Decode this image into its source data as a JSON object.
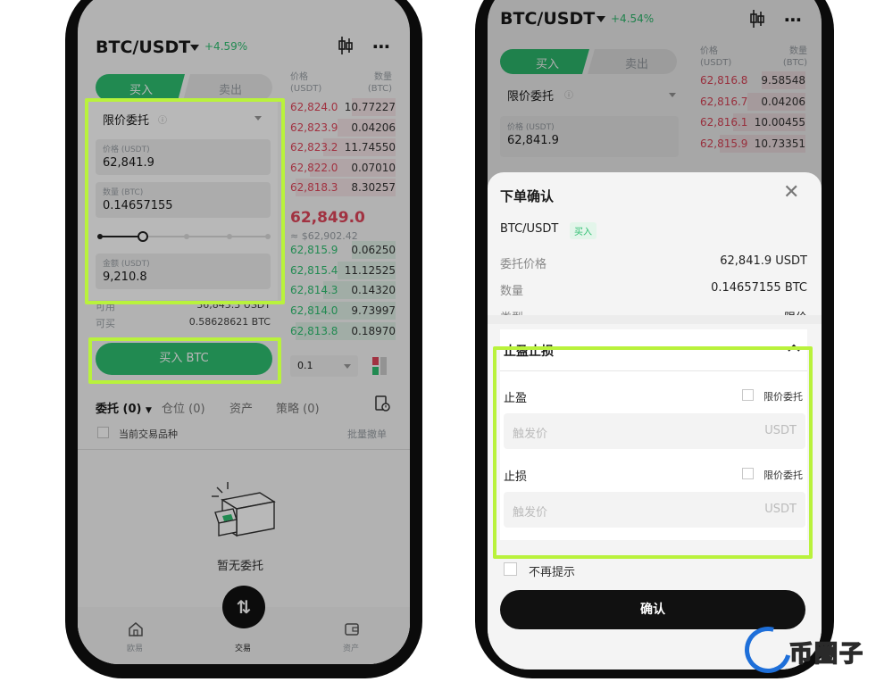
{
  "left": {
    "pair": "BTC/USDT",
    "change": "+4.59%",
    "tabs": {
      "buy": "买入",
      "sell": "卖出"
    },
    "book_headers": {
      "price": "价格",
      "price_unit": "(USDT)",
      "qty": "数量",
      "qty_unit": "(BTC)"
    },
    "order_type": "限价委托",
    "price_label": "价格 (USDT)",
    "price_value": "62,841.9",
    "qty_label": "数量 (BTC)",
    "qty_value": "0.14657155",
    "amount_label": "金额 (USDT)",
    "amount_value": "9,210.8",
    "slider_fraction": 0.25,
    "asks": [
      {
        "price": "62,824.0",
        "qty": "10.77227"
      },
      {
        "price": "62,823.9",
        "qty": "0.04206"
      },
      {
        "price": "62,823.2",
        "qty": "11.74550"
      },
      {
        "price": "62,822.0",
        "qty": "0.07010"
      },
      {
        "price": "62,818.3",
        "qty": "8.30257"
      }
    ],
    "last_price": "62,849.0",
    "last_price_usd": "≈ $62,902.42",
    "bids": [
      {
        "price": "62,815.9",
        "qty": "0.06250"
      },
      {
        "price": "62,815.4",
        "qty": "11.12525"
      },
      {
        "price": "62,814.3",
        "qty": "0.14320"
      },
      {
        "price": "62,814.0",
        "qty": "9.73997"
      },
      {
        "price": "62,813.8",
        "qty": "0.18970"
      }
    ],
    "available_label": "可用",
    "available_value": "36,843.3 USDT",
    "can_buy_label": "可买",
    "can_buy_value": "0.58628621 BTC",
    "buy_button": "买入 BTC",
    "depth_step": "0.1",
    "bottom_tabs": [
      "委托 (0)",
      "仓位 (0)",
      "资产",
      "策略 (0)"
    ],
    "current_pair_only": "当前交易品种",
    "batch_cancel": "批量撤单",
    "empty_text": "暂无委托",
    "nav": {
      "home": "欧易",
      "trade": "交易",
      "assets": "资产"
    }
  },
  "right": {
    "pair": "BTC/USDT",
    "change": "+4.54%",
    "tabs": {
      "buy": "买入",
      "sell": "卖出"
    },
    "book_headers": {
      "price": "价格",
      "price_unit": "(USDT)",
      "qty": "数量",
      "qty_unit": "(BTC)"
    },
    "order_type": "限价委托",
    "price_label": "价格 (USDT)",
    "price_value": "62,841.9",
    "asks": [
      {
        "price": "62,816.8",
        "qty": "9.58548"
      },
      {
        "price": "62,816.7",
        "qty": "0.04206"
      },
      {
        "price": "62,816.1",
        "qty": "10.00455"
      },
      {
        "price": "62,815.9",
        "qty": "10.73351"
      }
    ],
    "sheet": {
      "title": "下单确认",
      "pair": "BTC/USDT",
      "side_badge": "买入",
      "rows": [
        {
          "label": "委托价格",
          "value": "62,841.9 USDT"
        },
        {
          "label": "数量",
          "value": "0.14657155 BTC"
        },
        {
          "label": "类型",
          "value": "限价"
        }
      ],
      "tpsl_title": "止盈止损",
      "tp_label": "止盈",
      "sl_label": "止损",
      "limit_order_label": "限价委托",
      "trigger_placeholder": "触发价",
      "trigger_unit": "USDT",
      "dont_show_again": "不再提示",
      "confirm_button": "确认"
    }
  },
  "watermark": {
    "text": "币圈子"
  },
  "colors": {
    "green": "#2fbf71",
    "red": "#e0465a",
    "highlight": "#b9f23c"
  }
}
